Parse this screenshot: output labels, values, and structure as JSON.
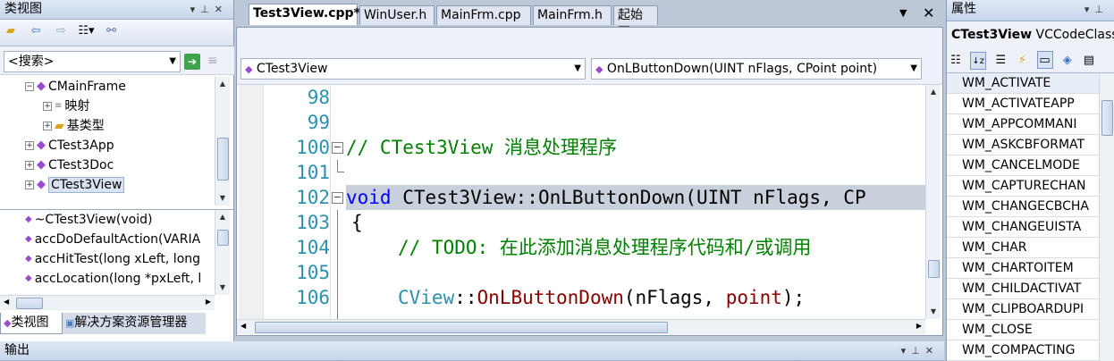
{
  "class_view": {
    "title": "类视图",
    "search_placeholder": "<搜索>",
    "tree": [
      {
        "label": "CMainFrame",
        "expander": "−",
        "indent": 0
      },
      {
        "label": "映射",
        "expander": "+",
        "indent": 1
      },
      {
        "label": "基类型",
        "expander": "+",
        "indent": 1
      },
      {
        "label": "CTest3App",
        "expander": "+",
        "indent": 0
      },
      {
        "label": "CTest3Doc",
        "expander": "+",
        "indent": 0
      },
      {
        "label": "CTest3View",
        "expander": "+",
        "indent": 0,
        "selected": true
      }
    ],
    "members": [
      "~CTest3View(void)",
      "accDoDefaultAction(VARIA",
      "accHitTest(long xLeft, long",
      "accLocation(long *pxLeft, l"
    ],
    "bottom_tabs": [
      "类视图",
      "解决方案资源管理器"
    ]
  },
  "editor": {
    "tabs": [
      {
        "label": "Test3View.cpp*",
        "active": true
      },
      {
        "label": "WinUser.h",
        "active": false
      },
      {
        "label": "MainFrm.cpp",
        "active": false
      },
      {
        "label": "MainFrm.h",
        "active": false
      },
      {
        "label": "起始页",
        "active": false
      }
    ],
    "class_combo": "CTest3View",
    "method_combo": "OnLButtonDown(UINT nFlags, CPoint point)",
    "line_numbers": [
      "98",
      "99",
      "100",
      "101",
      "102",
      "103",
      "104",
      "105",
      "106"
    ],
    "code": {
      "l100_comment": "// CTest3View 消息处理程序",
      "l102_kw": "void",
      "l102_rest": " CTest3View::OnLButtonDown(UINT nFlags, CP",
      "l103": "{",
      "l104_comment": "// TODO: 在此添加消息处理程序代码和/或调用",
      "l106_type": "CView",
      "l106_sep": "::",
      "l106_fn": "OnLButtonDown",
      "l106_open": "(nFlags, ",
      "l106_arg": "point",
      "l106_close": ");"
    }
  },
  "properties": {
    "title": "属性",
    "object_name": "CTest3View",
    "object_type": "VCCodeClass",
    "messages": [
      "WM_ACTIVATE",
      "WM_ACTIVATEAPP",
      "WM_APPCOMMANI",
      "WM_ASKCBFORMAT",
      "WM_CANCELMODE",
      "WM_CAPTURECHAN",
      "WM_CHANGECBCHA",
      "WM_CHANGEUISTA",
      "WM_CHAR",
      "WM_CHARTOITEM",
      "WM_CHILDACTIVAT",
      "WM_CLIPBOARDUPI",
      "WM_CLOSE",
      "WM_COMPACTING"
    ]
  },
  "output": {
    "title": "输出"
  }
}
